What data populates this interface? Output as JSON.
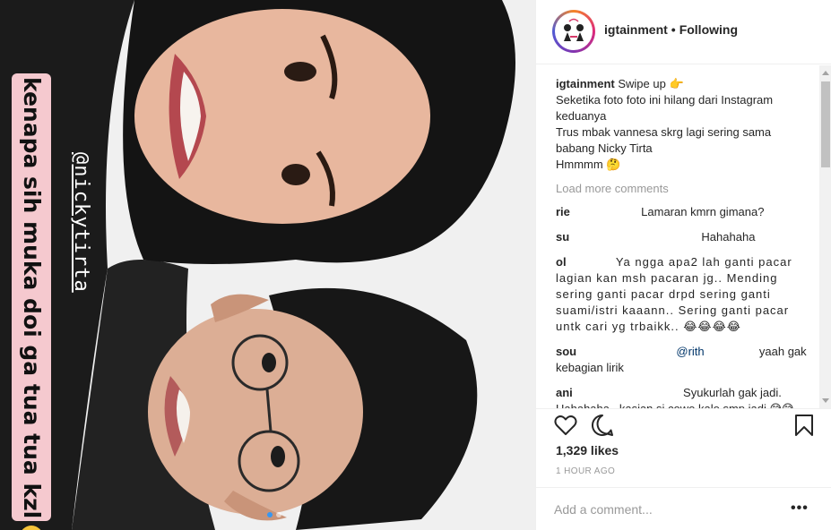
{
  "photo": {
    "caption": "kenapa sih muka doi ga tua tua kzl",
    "handle": "@nickytirta"
  },
  "header": {
    "username": "igtainment",
    "separator": "•",
    "follow_status": "Following"
  },
  "post": {
    "username": "igtainment",
    "first_line": "Swipe up 👉",
    "lines": [
      "Seketika foto foto ini hilang dari Instagram",
      "keduanya",
      "Trus mbak vannesa skrg lagi sering sama",
      "babang Nicky Tirta",
      "Hmmmm 🤔"
    ]
  },
  "load_more": "Load more comments",
  "comments": [
    {
      "user": "rie",
      "text": "Lamaran kmrn gimana?"
    },
    {
      "user": "su",
      "text": "Hahahaha"
    },
    {
      "user": "ol",
      "text": "Ya ngga apa2 lah ganti pacar lagian kan msh pacaran jg.. Mending sering ganti pacar drpd sering ganti suami/istri kaaann.. Sering ganti pacar untk cari yg trbaikk.. 😂😂😂😂"
    },
    {
      "user": "sou",
      "mention": "@rith",
      "text": "yaah gak kebagian lirik"
    },
    {
      "user": "ani",
      "text": "Syukurlah gak jadi. Hahahaha.. kasian si cowo kalo smp jadi 😅😅"
    }
  ],
  "likes": "1,329 likes",
  "time": "1 HOUR AGO",
  "add_comment_placeholder": "Add a comment...",
  "more_options": "•••",
  "icons": {
    "like": "heart-icon",
    "comment": "speech-bubble-icon",
    "save": "bookmark-icon"
  },
  "colors": {
    "caption_bg": "#f5c9cf",
    "mention": "#003569",
    "muted": "#999999"
  }
}
